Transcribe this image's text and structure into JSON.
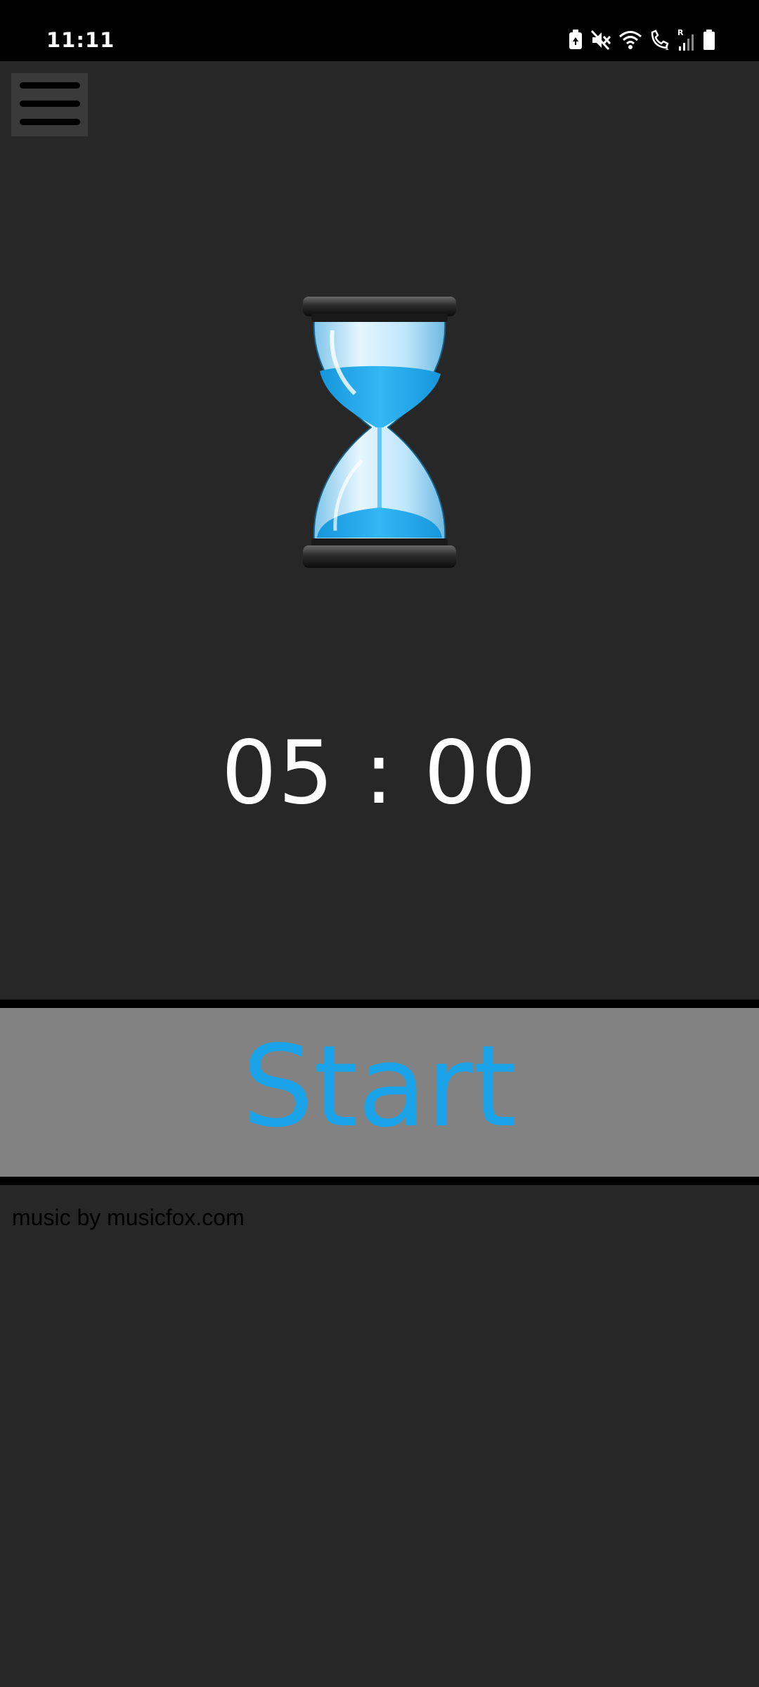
{
  "status_bar": {
    "time": "11:11",
    "icons": [
      "battery-saver-icon",
      "mute-icon",
      "wifi-icon",
      "wifi-calling-icon",
      "signal-icon",
      "battery-icon"
    ],
    "roaming_label": "R"
  },
  "menu": {
    "icon": "hamburger-menu-icon"
  },
  "hourglass": {
    "icon": "hourglass-icon",
    "sand_color": "#1aa3e8"
  },
  "timer": {
    "display": "05 : 00"
  },
  "start_button": {
    "label": "Start",
    "label_color": "#1aa3e8",
    "background": "#828282"
  },
  "credit": {
    "text": "music by musicfox.com"
  }
}
